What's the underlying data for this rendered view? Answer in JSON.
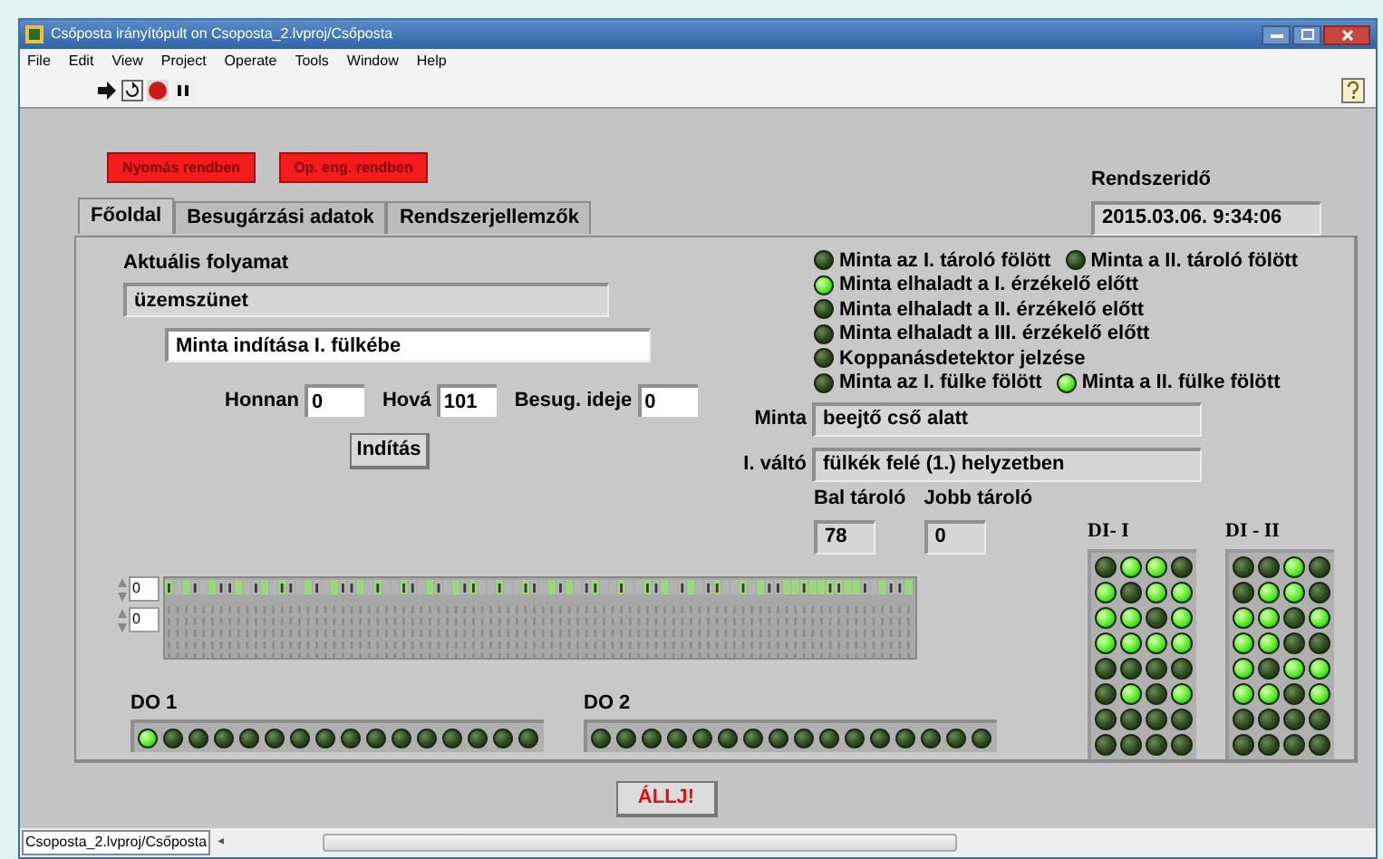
{
  "window": {
    "title": "Csőposta irányítópult on Csoposta_2.lvproj/Csőposta"
  },
  "menu": [
    "File",
    "Edit",
    "View",
    "Project",
    "Operate",
    "Tools",
    "Window",
    "Help"
  ],
  "alarms": [
    {
      "label": "Nyomás rendben",
      "on": true
    },
    {
      "label": "Op. eng. rendben",
      "on": true
    }
  ],
  "system_time": {
    "label": "Rendszeridő",
    "value": "2015.03.06. 9:34:06"
  },
  "tabs": [
    {
      "label": "Főoldal",
      "selected": true
    },
    {
      "label": "Besugárzási adatok",
      "selected": false
    },
    {
      "label": "Rendszerjellemzők",
      "selected": false
    }
  ],
  "process": {
    "label": "Aktuális folyamat",
    "value": "üzemszünet",
    "command": "Minta indítása I. fülkébe"
  },
  "params": [
    {
      "label": "Honnan",
      "value": "0"
    },
    {
      "label": "Hová",
      "value": "101"
    },
    {
      "label": "Besug. ideje",
      "value": "0"
    }
  ],
  "start_button": "Indítás",
  "indicators": [
    [
      {
        "label": "Minta az I. tároló fölött",
        "on": false
      },
      {
        "label": "Minta a II. tároló fölött",
        "on": false
      }
    ],
    [
      {
        "label": "Minta elhaladt a I. érzékelő előtt",
        "on": true
      }
    ],
    [
      {
        "label": "Minta elhaladt a II. érzékelő előtt",
        "on": false
      }
    ],
    [
      {
        "label": "Minta elhaladt a III. érzékelő előtt",
        "on": false
      }
    ],
    [
      {
        "label": "Koppanásdetektor jelzése",
        "on": false
      }
    ],
    [
      {
        "label": "Minta az I. fülke fölött",
        "on": false
      },
      {
        "label": "Minta a II. fülke fölött",
        "on": true
      }
    ]
  ],
  "status_fields": [
    {
      "label": "Minta",
      "value": "beejtő cső alatt"
    },
    {
      "label": "I. váltó",
      "value": "fülkék felé (1.) helyzetben"
    }
  ],
  "storages": [
    {
      "label": "Bal tároló",
      "value": "78"
    },
    {
      "label": "Jobb tároló",
      "value": "0"
    }
  ],
  "table_indices": [
    "0",
    "0"
  ],
  "do_arrays": [
    {
      "label": "DO 1",
      "leds": [
        {
          "on": true
        },
        {
          "on": false
        },
        {
          "on": false
        },
        {
          "on": false
        },
        {
          "on": false
        },
        {
          "on": false
        },
        {
          "on": false
        },
        {
          "on": false
        },
        {
          "on": false
        },
        {
          "on": false
        },
        {
          "on": false
        },
        {
          "on": false
        },
        {
          "on": false
        },
        {
          "on": false
        },
        {
          "on": false
        },
        {
          "on": false
        }
      ]
    },
    {
      "label": "DO 2",
      "leds": [
        {
          "on": false
        },
        {
          "on": false
        },
        {
          "on": false
        },
        {
          "on": false
        },
        {
          "on": false
        },
        {
          "on": false
        },
        {
          "on": false
        },
        {
          "on": false
        },
        {
          "on": false
        },
        {
          "on": false
        },
        {
          "on": false
        },
        {
          "on": false
        },
        {
          "on": false
        },
        {
          "on": false
        },
        {
          "on": false
        },
        {
          "on": false
        }
      ]
    }
  ],
  "di_grids": [
    {
      "label": "DI- I",
      "rows": [
        [
          {
            "on": false
          },
          {
            "on": true
          },
          {
            "on": true
          },
          {
            "on": false
          }
        ],
        [
          {
            "on": true
          },
          {
            "on": false
          },
          {
            "on": true
          },
          {
            "on": true
          }
        ],
        [
          {
            "on": true
          },
          {
            "on": true
          },
          {
            "on": false
          },
          {
            "on": true
          }
        ],
        [
          {
            "on": true
          },
          {
            "on": true
          },
          {
            "on": true
          },
          {
            "on": true
          }
        ],
        [
          {
            "on": false
          },
          {
            "on": false
          },
          {
            "on": false
          },
          {
            "on": false
          }
        ],
        [
          {
            "on": false
          },
          {
            "on": true
          },
          {
            "on": false
          },
          {
            "on": true
          }
        ],
        [
          {
            "on": false
          },
          {
            "on": false
          },
          {
            "on": false
          },
          {
            "on": false
          }
        ],
        [
          {
            "on": false
          },
          {
            "on": false
          },
          {
            "on": false
          },
          {
            "on": false
          }
        ]
      ]
    },
    {
      "label": "DI - II",
      "rows": [
        [
          {
            "on": false
          },
          {
            "on": false
          },
          {
            "on": true
          },
          {
            "on": false
          }
        ],
        [
          {
            "on": false
          },
          {
            "on": true
          },
          {
            "on": true
          },
          {
            "on": false
          }
        ],
        [
          {
            "on": true
          },
          {
            "on": true
          },
          {
            "on": false
          },
          {
            "on": true
          }
        ],
        [
          {
            "on": true
          },
          {
            "on": true
          },
          {
            "on": false
          },
          {
            "on": false
          }
        ],
        [
          {
            "on": true
          },
          {
            "on": false
          },
          {
            "on": true
          },
          {
            "on": true
          }
        ],
        [
          {
            "on": true
          },
          {
            "on": true
          },
          {
            "on": false
          },
          {
            "on": true
          }
        ],
        [
          {
            "on": false
          },
          {
            "on": false
          },
          {
            "on": false
          },
          {
            "on": false
          }
        ],
        [
          {
            "on": false
          },
          {
            "on": false
          },
          {
            "on": false
          },
          {
            "on": false
          }
        ]
      ]
    }
  ],
  "stop_button": "ÁLLJ!",
  "status_bar": {
    "path": "Csoposta_2.lvproj/Csőposta",
    "scroll_arrow": "◂"
  }
}
